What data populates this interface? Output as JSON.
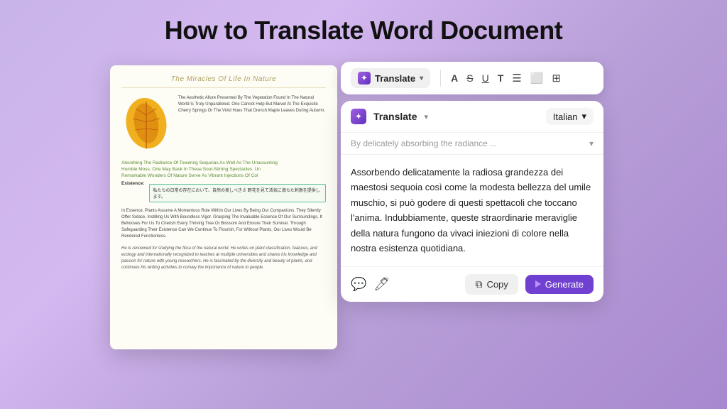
{
  "page": {
    "title": "How to Translate Word Document"
  },
  "toolbar": {
    "translate_label": "Translate",
    "chevron": "▾",
    "icons": [
      "A",
      "S̶",
      "U̲",
      "T",
      "☰",
      "□",
      "⊡"
    ]
  },
  "translate_panel": {
    "header": {
      "label": "Translate",
      "chevron": "▾",
      "language": "Italian",
      "lang_chevron": "▾"
    },
    "input_placeholder": "By delicately absorbing the radiance ...",
    "input_chevron": "▾",
    "output_text": "Assorbendo delicatamente la radiosa grandezza dei maestosi sequoia così come la modesta bellezza del umile muschio, si può godere di questi spettacoli che toccano l'anima. Indubbiamente, queste straordinarie meraviglie della natura fungono da vivaci iniezioni di colore nella nostra esistenza quotidiana.",
    "footer": {
      "copy_label": "Copy",
      "generate_label": "Generate"
    }
  },
  "doc": {
    "title": "The Miracles Of Life In Nature",
    "paragraph1": "The Aesthetic Allure Presented By The Vegetation Found In The Natural World Is Truly Unparalleled. One Cannot Help But Marvel At The Exquisite Cherry Springs Or The Vivid Hues That Drench Maple Leaves During Autumn.",
    "green1": "Absorbing The Radiance Of Towering Sequoias As Well As The Unassuming",
    "green2": "Humble Moss, One May Bask In These Soul-Stirring Spectacles. Un",
    "green3": "Remarkable Wonders Of Nature Serve As Vibrant Injections Of Col",
    "highlight_jp": "私たちの日常の存在において、自然の美しべきさ\n野花を見て活気に満ちた刺激を提供します。",
    "paragraph2": "In Essence, Plants Assume A Momentous Role Within Our Lives By Being Our Companions. They Silently Offer Solace, Instilling Us With Boundless Vigor. Grasping The Invaluable Essence Of Our Surroundings, It Behooves For Us To Cherish Every Thriving Tree Or Blossom And Ensure Their Survival. Through Safeguarding Their Existence Can We Continue To Flourish, For Without Plants, Our Lives Would Be Rendered Functionless.",
    "italic_bio": "He is renowned for studying the flora of the natural world. He writes on plant classification, features, and ecology and internationally recognized to teaches at multiple universities and shares his knowledge and passion for nature with young researchers. He is fascinated by the diversity and beauty of plants, and continues his writing activities to convey the importance of nature to people."
  }
}
